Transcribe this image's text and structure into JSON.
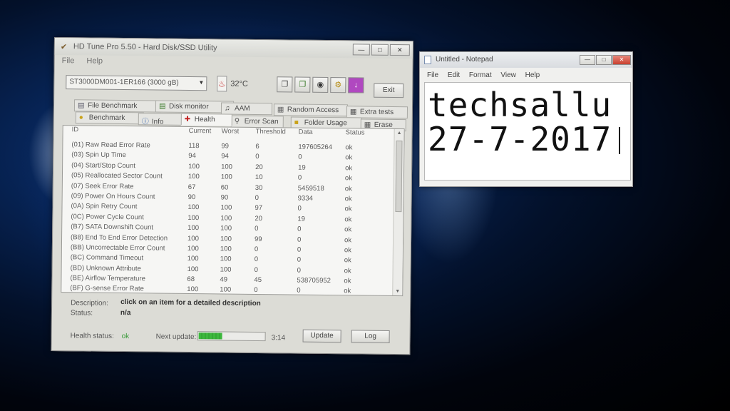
{
  "hdtune": {
    "title": "HD Tune Pro 5.50 - Hard Disk/SSD Utility",
    "menu": [
      "File",
      "Help"
    ],
    "drive": "ST3000DM001-1ER166 (3000 gB)",
    "temperature": "32°C",
    "exit_label": "Exit",
    "tabs": {
      "file_benchmark": "File Benchmark",
      "disk_monitor": "Disk monitor",
      "aam": "AAM",
      "random_access": "Random Access",
      "extra_tests": "Extra tests",
      "benchmark": "Benchmark",
      "info": "Info",
      "health": "Health",
      "error_scan": "Error Scan",
      "folder_usage": "Folder Usage",
      "erase": "Erase"
    },
    "columns": [
      "ID",
      "Current",
      "Worst",
      "Threshold",
      "Data",
      "Status"
    ],
    "rows": [
      {
        "id": "(01) Raw Read Error Rate",
        "current": "118",
        "worst": "99",
        "threshold": "6",
        "data": "197605264",
        "status": "ok"
      },
      {
        "id": "(03) Spin Up Time",
        "current": "94",
        "worst": "94",
        "threshold": "0",
        "data": "0",
        "status": "ok"
      },
      {
        "id": "(04) Start/Stop Count",
        "current": "100",
        "worst": "100",
        "threshold": "20",
        "data": "19",
        "status": "ok"
      },
      {
        "id": "(05) Reallocated Sector Count",
        "current": "100",
        "worst": "100",
        "threshold": "10",
        "data": "0",
        "status": "ok"
      },
      {
        "id": "(07) Seek Error Rate",
        "current": "67",
        "worst": "60",
        "threshold": "30",
        "data": "5459518",
        "status": "ok"
      },
      {
        "id": "(09) Power On Hours Count",
        "current": "90",
        "worst": "90",
        "threshold": "0",
        "data": "9334",
        "status": "ok"
      },
      {
        "id": "(0A) Spin Retry Count",
        "current": "100",
        "worst": "100",
        "threshold": "97",
        "data": "0",
        "status": "ok"
      },
      {
        "id": "(0C) Power Cycle Count",
        "current": "100",
        "worst": "100",
        "threshold": "20",
        "data": "19",
        "status": "ok"
      },
      {
        "id": "(B7) SATA Downshift Count",
        "current": "100",
        "worst": "100",
        "threshold": "0",
        "data": "0",
        "status": "ok"
      },
      {
        "id": "(B8) End To End Error Detection",
        "current": "100",
        "worst": "100",
        "threshold": "99",
        "data": "0",
        "status": "ok"
      },
      {
        "id": "(BB) Uncorrectable Error Count",
        "current": "100",
        "worst": "100",
        "threshold": "0",
        "data": "0",
        "status": "ok"
      },
      {
        "id": "(BC) Command Timeout",
        "current": "100",
        "worst": "100",
        "threshold": "0",
        "data": "0",
        "status": "ok"
      },
      {
        "id": "(BD) Unknown Attribute",
        "current": "100",
        "worst": "100",
        "threshold": "0",
        "data": "0",
        "status": "ok"
      },
      {
        "id": "(BE) Airflow Temperature",
        "current": "68",
        "worst": "49",
        "threshold": "45",
        "data": "538705952",
        "status": "ok"
      },
      {
        "id": "(BF) G-sense Error Rate",
        "current": "100",
        "worst": "100",
        "threshold": "0",
        "data": "0",
        "status": "ok"
      }
    ],
    "description_label": "Description:",
    "description_value": "click on an item for a detailed description",
    "status_label": "Status:",
    "status_value": "n/a",
    "health_label": "Health status:",
    "health_value": "ok",
    "next_update_label": "Next update:",
    "next_update_progress": 0.35,
    "timer": "3:14",
    "update_label": "Update",
    "log_label": "Log",
    "colors": {
      "ok_green": "#3a9a3a",
      "temp_red": "#c32323",
      "progress_green": "#3db83d"
    }
  },
  "notepad": {
    "title": "Untitled - Notepad",
    "menu": [
      "File",
      "Edit",
      "Format",
      "View",
      "Help"
    ],
    "line1": "techsallu",
    "line2": "27-7-2017"
  }
}
